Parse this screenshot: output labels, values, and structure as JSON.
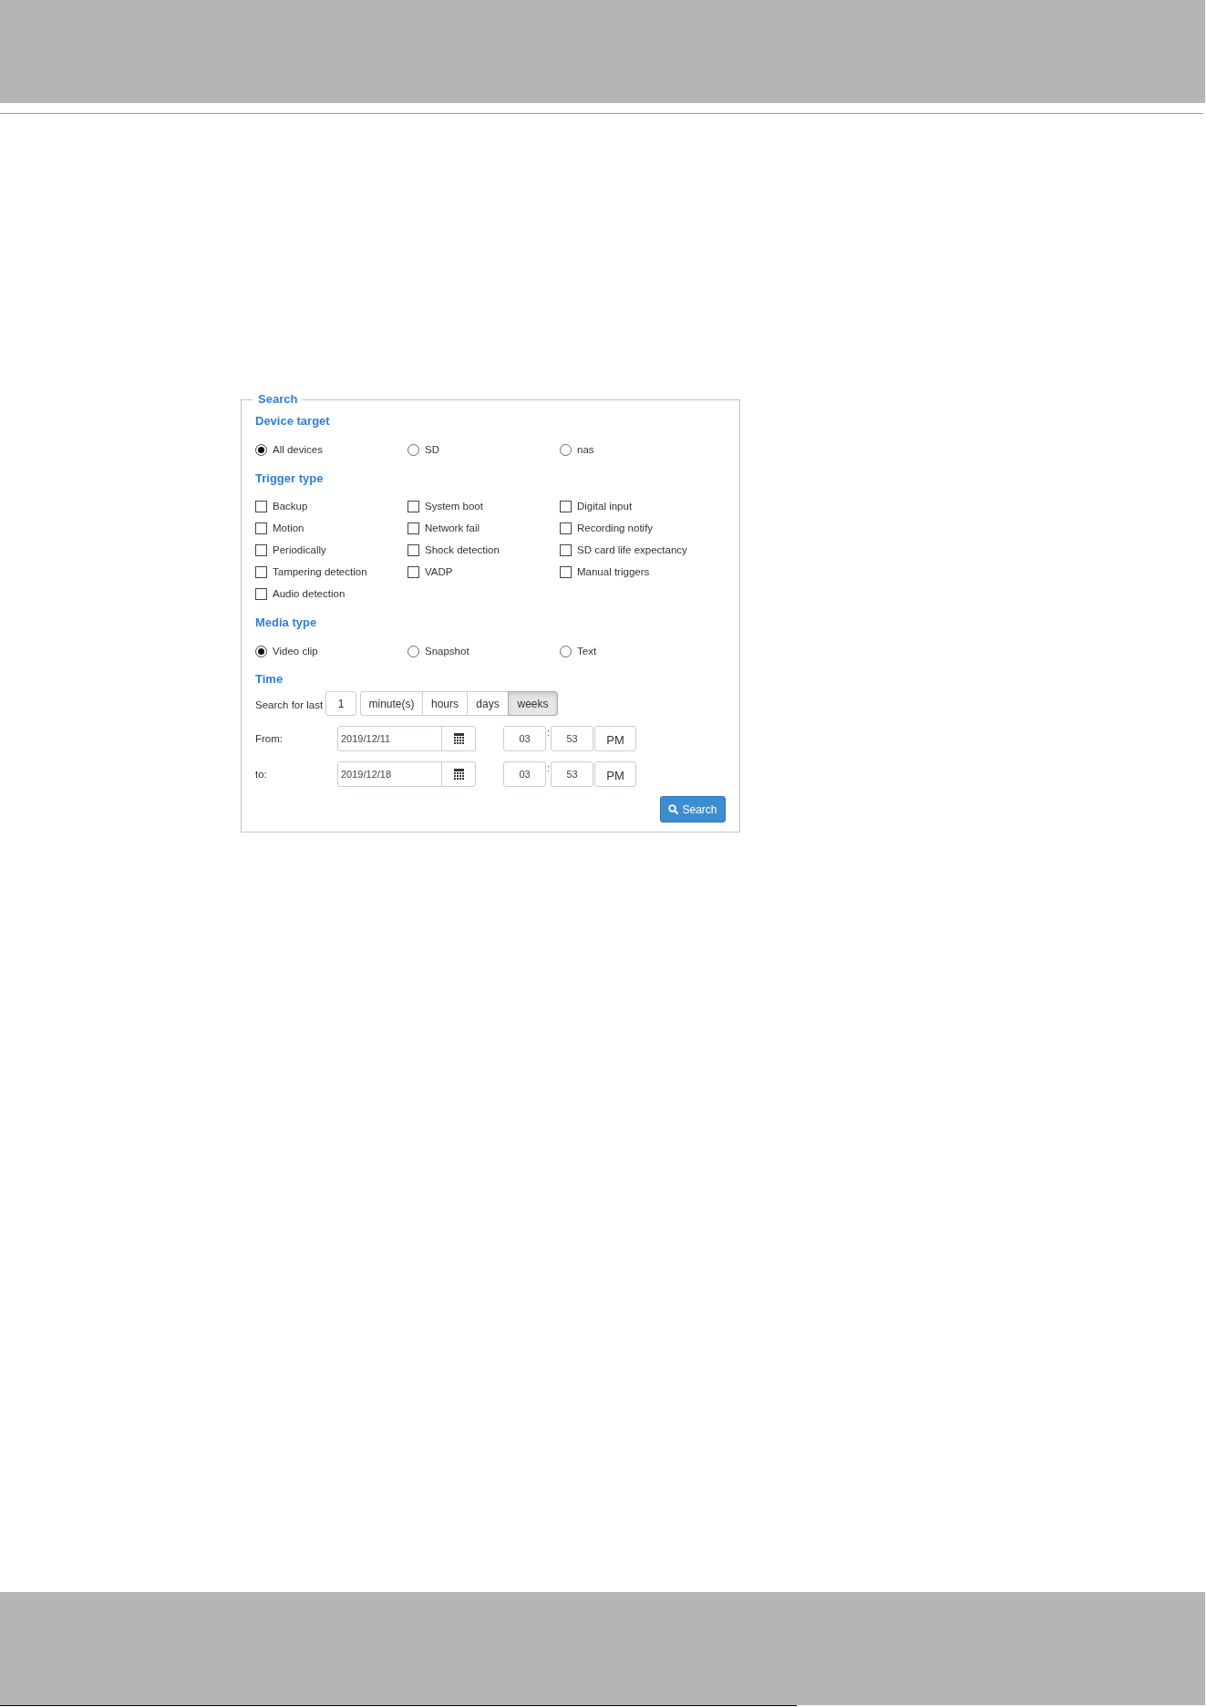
{
  "search_panel": {
    "legend": "Search"
  },
  "device_target": {
    "heading": "Device target",
    "options": [
      {
        "label": "All devices",
        "selected": true
      },
      {
        "label": "SD",
        "selected": false
      },
      {
        "label": "nas",
        "selected": false
      }
    ]
  },
  "trigger_type": {
    "heading": "Trigger type",
    "options": [
      {
        "label": "Backup",
        "checked": false
      },
      {
        "label": "System boot",
        "checked": false
      },
      {
        "label": "Digital input",
        "checked": false
      },
      {
        "label": "Motion",
        "checked": false
      },
      {
        "label": "Network fail",
        "checked": false
      },
      {
        "label": "Recording notify",
        "checked": false
      },
      {
        "label": "Periodically",
        "checked": false
      },
      {
        "label": "Shock detection",
        "checked": false
      },
      {
        "label": "SD card life expectancy",
        "checked": false
      },
      {
        "label": "Tampering detection",
        "checked": false
      },
      {
        "label": "VADP",
        "checked": false
      },
      {
        "label": "Manual triggers",
        "checked": false
      },
      {
        "label": "Audio detection",
        "checked": false
      }
    ]
  },
  "media_type": {
    "heading": "Media type",
    "options": [
      {
        "label": "Video clip",
        "selected": true
      },
      {
        "label": "Snapshot",
        "selected": false
      },
      {
        "label": "Text",
        "selected": false
      }
    ]
  },
  "time": {
    "heading": "Time",
    "search_for_last": {
      "label": "Search for last",
      "value": "1",
      "units": [
        {
          "label": "minute(s)",
          "selected": false
        },
        {
          "label": "hours",
          "selected": false
        },
        {
          "label": "days",
          "selected": false
        },
        {
          "label": "weeks",
          "selected": true
        }
      ]
    },
    "ranges": [
      {
        "label": "From:",
        "date": "2019/12/11",
        "hour": "03",
        "separator": ":",
        "minute": "53",
        "period": "PM"
      },
      {
        "label": "to:",
        "date": "2019/12/18",
        "hour": "03",
        "separator": ":",
        "minute": "53",
        "period": "PM"
      }
    ]
  },
  "search_button": {
    "label": "Search"
  }
}
